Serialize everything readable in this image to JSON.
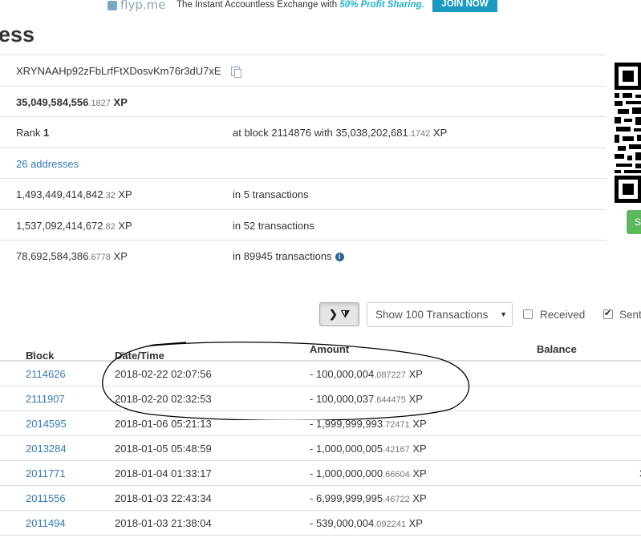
{
  "banner": {
    "logo_text": "flyp.me",
    "tagline_prefix": "The Instant Accountless Exchange with ",
    "tagline_highlight": "50% Profit Sharing.",
    "join_label": "JOIN NOW",
    "accent_color": "#1a9ac0"
  },
  "page": {
    "title": "ess"
  },
  "info": {
    "address": "XRYNAAHp92zFbLrfFtXDosvKm76r3dU7xE",
    "balance_main": "35,049,584,556",
    "balance_frac": ".1827",
    "balance_unit": " XP",
    "rank_label": "Rank ",
    "rank_value": "1",
    "rank_block_text": "at block 2114876 with 35,038,202,681",
    "rank_block_frac": ".1742",
    "rank_block_unit": " XP",
    "addresses_link": "26 addresses",
    "received_main": "1,493,449,414,842",
    "received_frac": ".32",
    "received_unit": " XP",
    "received_tx": "in 5 transactions",
    "sent_main": "1,537,092,414,672",
    "sent_frac": ".82",
    "sent_unit": " XP",
    "sent_tx": "in 52 transactions",
    "other_main": "78,692,584,386",
    "other_frac": ".6778",
    "other_unit": " XP",
    "other_tx": "in 89945 transactions"
  },
  "side": {
    "green_button_label": "S"
  },
  "toolbar": {
    "filter_label": "❯ ⧩",
    "select_value": "Show 100 Transactions",
    "received_label": "Received",
    "received_checked": false,
    "sent_label": "Sent",
    "sent_checked": true
  },
  "table": {
    "headers": {
      "block": "Block",
      "date": "Date/Time",
      "amount": "Amount",
      "balance": "Balance"
    },
    "rows": [
      {
        "block": "2114626",
        "date": "2018-02-22 02:07:56",
        "amount_main": "- 100,000,004",
        "amount_frac": ".087227",
        "unit": " XP",
        "edge": ""
      },
      {
        "block": "2111907",
        "date": "2018-02-20 02:32:53",
        "amount_main": "- 100,000,037",
        "amount_frac": ".644475",
        "unit": " XP",
        "edge": ""
      },
      {
        "block": "2014595",
        "date": "2018-01-06 05:21:13",
        "amount_main": "- 1,999,999,993",
        "amount_frac": ".72471",
        "unit": " XP",
        "edge": ""
      },
      {
        "block": "2013284",
        "date": "2018-01-05 05:48:59",
        "amount_main": "- 1,000,000,005",
        "amount_frac": ".42167",
        "unit": " XP",
        "edge": ""
      },
      {
        "block": "2011771",
        "date": "2018-01-04 01:33:17",
        "amount_main": "- 1,000,000,000",
        "amount_frac": ".66604",
        "unit": " XP",
        "edge": "3"
      },
      {
        "block": "2011556",
        "date": "2018-01-03 22:43:34",
        "amount_main": "- 6,999,999,995",
        "amount_frac": ".46722",
        "unit": " XP",
        "edge": ""
      },
      {
        "block": "2011494",
        "date": "2018-01-03 21:38:04",
        "amount_main": "- 539,000,004",
        "amount_frac": ".092241",
        "unit": " XP",
        "edge": ""
      }
    ]
  }
}
